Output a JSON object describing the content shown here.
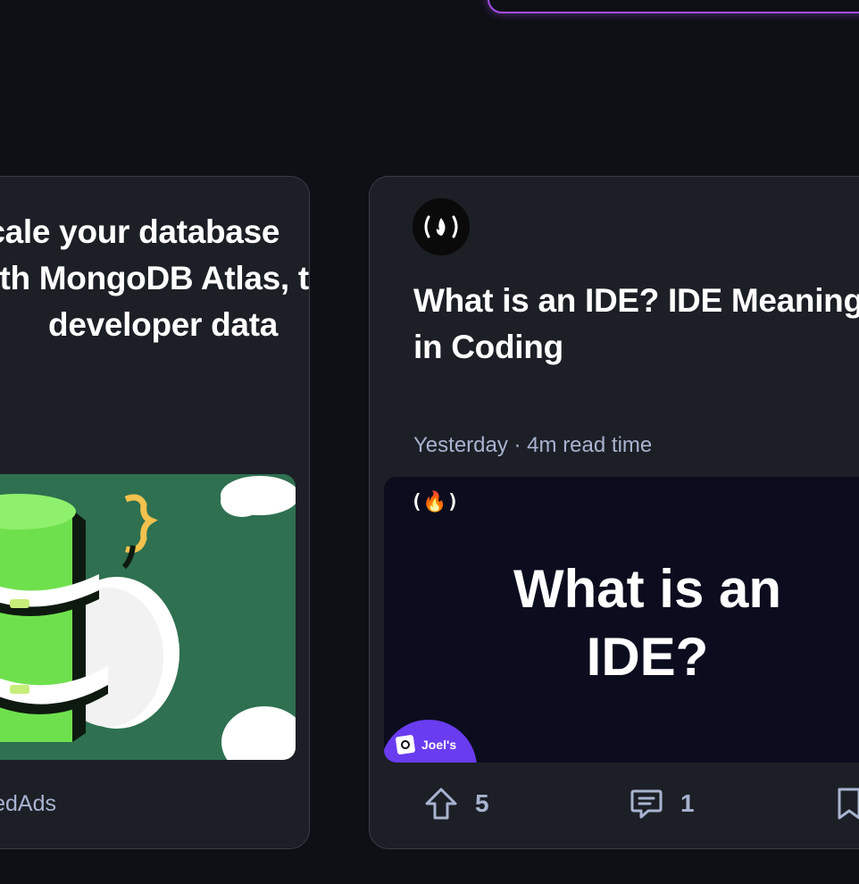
{
  "left_card": {
    "title_lines": [
      "Scale your database",
      "with MongoDB Atlas, the",
      "developer data"
    ],
    "source": "PromotedAds",
    "image_icon": "database-stack-illustration"
  },
  "right_card": {
    "avatar_icon": "freecodecamp-logo-icon",
    "title": "What is an IDE? IDE Meaning in Coding",
    "meta": "Yesterday · 4m read time",
    "thumbnail": {
      "logo_text": "(🔥)",
      "headline_lines": [
        "What is an",
        "IDE?"
      ],
      "badge_text": "Joel's",
      "badge_icon": "joels-blog-icon"
    },
    "actions": {
      "upvote_count": "5",
      "comment_count": "1",
      "upvote_icon": "upvote-arrow-icon",
      "comment_icon": "comment-bubble-icon",
      "bookmark_icon": "bookmark-icon"
    }
  },
  "colors": {
    "background": "#0e1015",
    "card": "#1c1f26",
    "accent_purple": "#a24ee6",
    "muted_text": "#a8b3cf"
  }
}
